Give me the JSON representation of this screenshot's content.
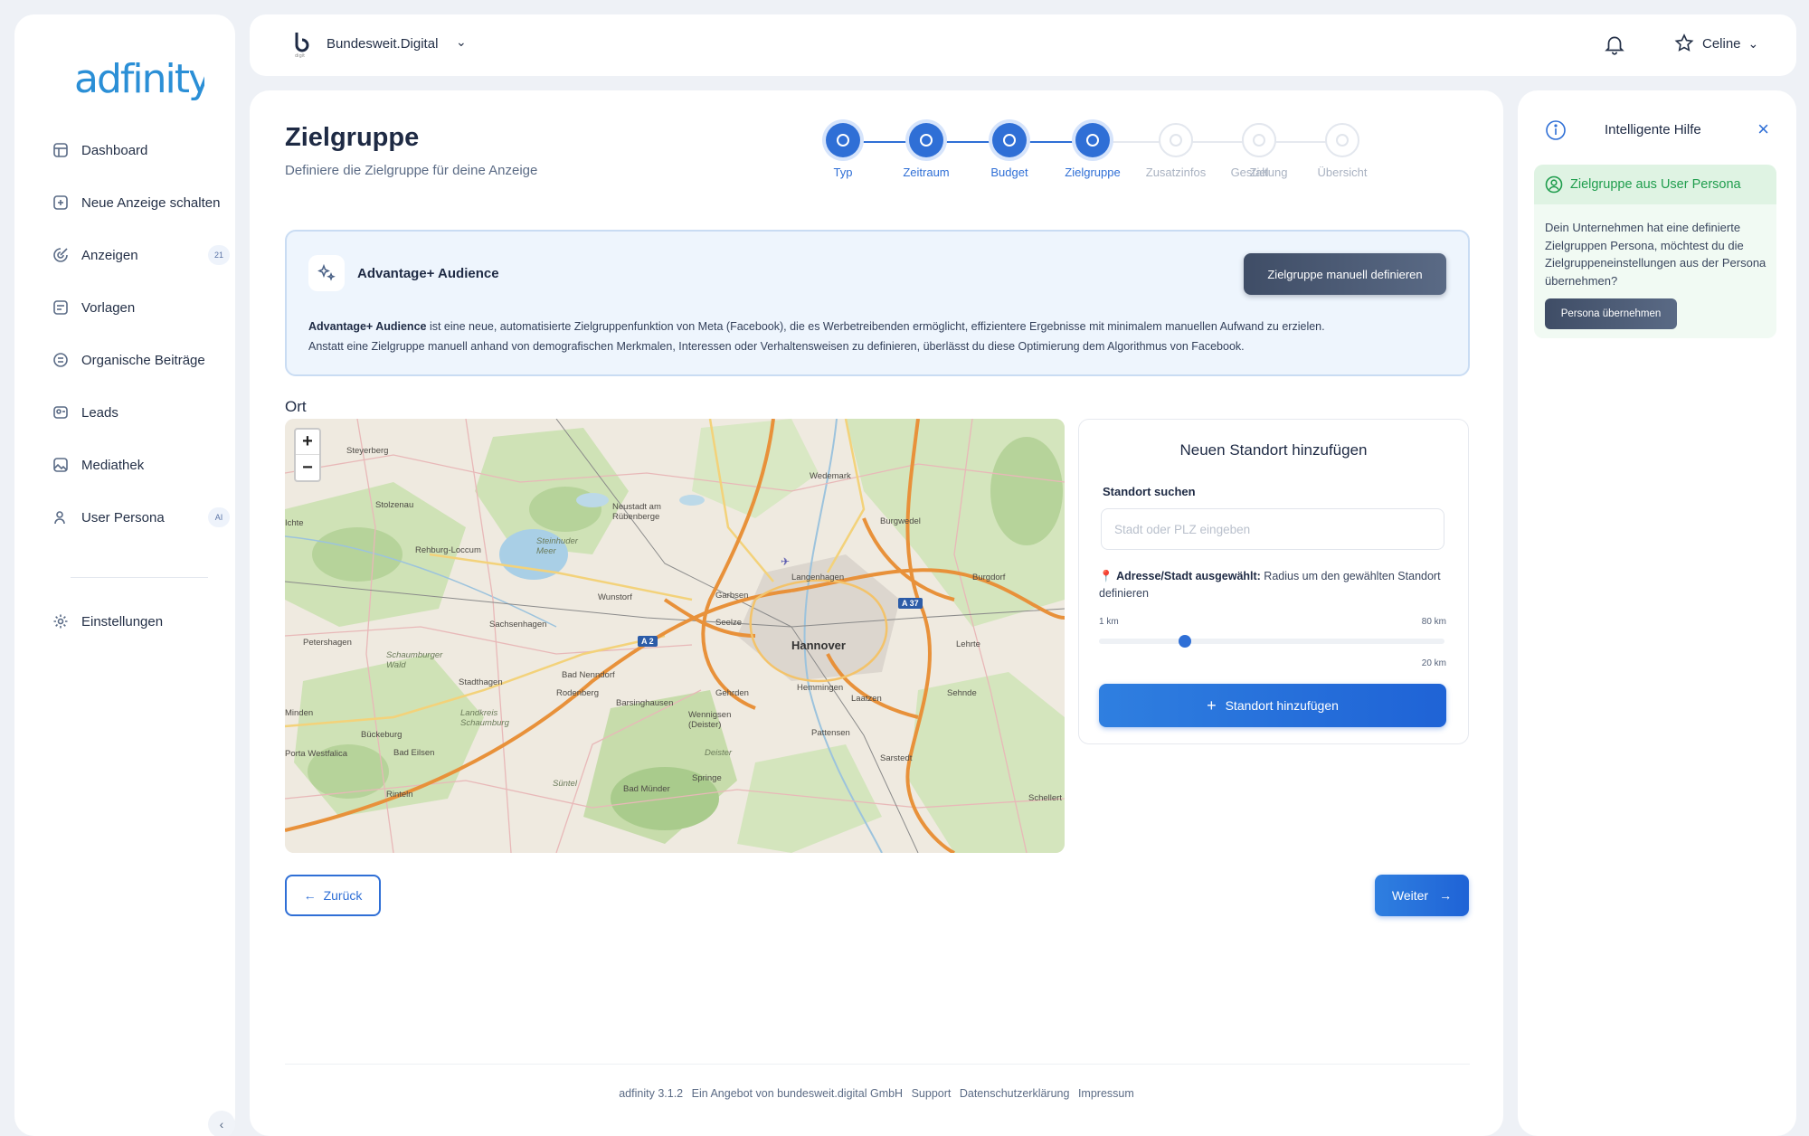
{
  "sidebar": {
    "logo_text": "adfinity",
    "items": [
      {
        "label": "Dashboard",
        "icon": "dashboard-icon"
      },
      {
        "label": "Neue Anzeige schalten",
        "icon": "add-ad-icon"
      },
      {
        "label": "Anzeigen",
        "icon": "ads-icon",
        "badge": "21"
      },
      {
        "label": "Vorlagen",
        "icon": "templates-icon"
      },
      {
        "label": "Organische Beiträge",
        "icon": "posts-icon"
      },
      {
        "label": "Leads",
        "icon": "leads-icon"
      },
      {
        "label": "Mediathek",
        "icon": "media-icon"
      },
      {
        "label": "User Persona",
        "icon": "persona-icon",
        "badge": "AI"
      }
    ],
    "settings_label": "Einstellungen"
  },
  "topbar": {
    "workspace": "Bundesweit.Digital",
    "user_name": "Celine"
  },
  "page": {
    "title": "Zielgruppe",
    "subtitle": "Definiere die Zielgruppe für deine Anzeige"
  },
  "stepper": {
    "steps": [
      {
        "label": "Typ",
        "done": true
      },
      {
        "label": "Zeitraum",
        "done": true
      },
      {
        "label": "Budget",
        "done": true
      },
      {
        "label": "Zielgruppe",
        "done": true
      },
      {
        "label": "Zusatzinfos",
        "done": false
      },
      {
        "label": "Ziel",
        "done": false
      },
      {
        "label": "Gestaltung",
        "done": false
      },
      {
        "label": "Übersicht",
        "done": false
      }
    ]
  },
  "advantage": {
    "title": "Advantage+ Audience",
    "button": "Zielgruppe manuell definieren",
    "bold_lead": "Advantage+ Audience",
    "text_1": " ist eine neue, automatisierte Zielgruppenfunktion von Meta (Facebook), die es Werbetreibenden ermöglicht, effizientere Ergebnisse mit minimalem manuellen Aufwand zu erzielen.",
    "text_2": "Anstatt eine Zielgruppe manuell anhand von demografischen Merkmalen, Interessen oder Verhaltensweisen zu definieren, überlässt du diese Optimierung dem Algorithmus von Facebook."
  },
  "location": {
    "section_label": "Ort",
    "card_title": "Neuen Standort hinzufügen",
    "search_label": "Standort suchen",
    "search_placeholder": "Stadt oder PLZ eingeben",
    "note_bold": "Adresse/Stadt ausgewählt:",
    "note_text": " Radius um den gewählten Standort definieren",
    "radius_min": "1 km",
    "radius_max": "80 km",
    "radius_value": "20 km",
    "radius_fraction": 0.24,
    "add_button": "Standort hinzufügen"
  },
  "map": {
    "labels": [
      "Steyerberg",
      "Stolzenau",
      "Wedemark",
      "Neustadt am Rübenberge",
      "Burgwedel",
      "Rehburg-Loccum",
      "Steinhuder Meer",
      "Langenhagen",
      "Burgdorf",
      "Wunstorf",
      "Garbsen",
      "Sachsenhagen",
      "Seelze",
      "Hannover",
      "Lehrte",
      "Petershagen",
      "Schaumburger Wald",
      "Stadthagen",
      "Bad Nenndorf",
      "Hemmingen",
      "Sehnde",
      "Rodenberg",
      "Barsinghausen",
      "Gehrden",
      "Laatzen",
      "Minden",
      "Landkreis Schaumburg",
      "Wennigsen (Deister)",
      "Bückeburg",
      "Pattensen",
      "Bad Eilsen",
      "Porta Westfalica",
      "Deister",
      "Sarstedt",
      "Springe",
      "Süntel",
      "Bad Münder",
      "Rinteln",
      "Schellert",
      "Ichte"
    ],
    "shields": [
      "A 2",
      "A 37"
    ],
    "zoom_in": "+",
    "zoom_out": "−"
  },
  "actions": {
    "back": "Zurück",
    "next": "Weiter"
  },
  "footer": {
    "version": "adfinity 3.1.2",
    "provider": "Ein Angebot von bundesweit.digital GmbH",
    "support": "Support",
    "privacy": "Datenschutzerklärung",
    "imprint": "Impressum"
  },
  "help": {
    "title": "Intelligente Hilfe",
    "card_title": "Zielgruppe aus User Persona",
    "card_text": "Dein Unternehmen hat eine definierte Zielgruppen Persona, möchtest du die Zielgruppeneinstellungen aus der Persona übernehmen?",
    "card_button": "Persona übernehmen"
  },
  "colors": {
    "accent": "#2f6fd6",
    "success": "#1f9d4d",
    "dark_button": "#3f4d66"
  }
}
